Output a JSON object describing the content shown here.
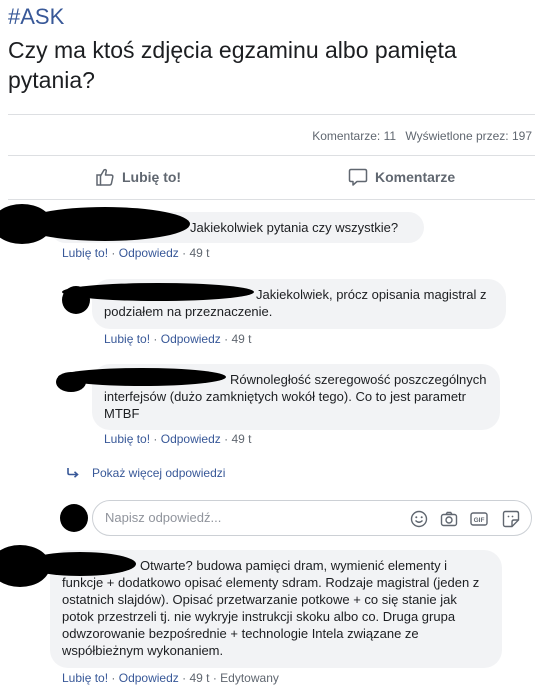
{
  "post": {
    "hashtag": "#ASK",
    "text": "Czy ma ktoś zdjęcia egzaminu albo pamięta pytania?"
  },
  "stats": {
    "comments": "Komentarze: 11",
    "views": "Wyświetlone przez: 197"
  },
  "actions": {
    "like": "Lubię to!",
    "comment": "Komentarze"
  },
  "comments": [
    {
      "text": "Jakiekolwiek pytania czy wszystkie?",
      "like": "Lubię to!",
      "reply": "Odpowiedz",
      "time": "49 t"
    },
    {
      "text": "Jakiekolwiek, prócz opisania magistral z podziałem na przeznaczenie.",
      "like": "Lubię to!",
      "reply": "Odpowiedz",
      "time": "49 t"
    },
    {
      "text": "Równoległość szeregowość poszczególnych interfejsów (dużo zamkniętych wokół tego). Co to jest parametr MTBF",
      "like": "Lubię to!",
      "reply": "Odpowiedz",
      "time": "49 t"
    },
    {
      "text": "Otwarte? budowa pamięci dram, wymienić elementy i funkcje + dodatkowo opisać elementy sdram. Rodzaje magistral (jeden z ostatnich slajdów). Opisać przetwarzanie potkowe + co się stanie jak potok przestrzeli tj. nie wykryje instrukcji skoku albo co. Druga grupa odwzorowanie bezpośrednie + technologie Intela związane ze współbieżnym wykonaniem.",
      "like": "Lubię to!",
      "reply": "Odpowiedz",
      "time": "49 t",
      "edited": "Edytowany"
    }
  ],
  "more_replies": "Pokaż więcej odpowiedzi",
  "reply_box": {
    "placeholder": "Napisz odpowiedź..."
  },
  "colors": {
    "link": "#385898",
    "muted": "#606770",
    "bubble": "#f2f3f5",
    "divider": "#dddfe2"
  },
  "icons": [
    "thumbs-up-icon",
    "comment-icon",
    "reply-arrow-icon",
    "emoji-icon",
    "camera-icon",
    "gif-icon",
    "sticker-icon"
  ]
}
